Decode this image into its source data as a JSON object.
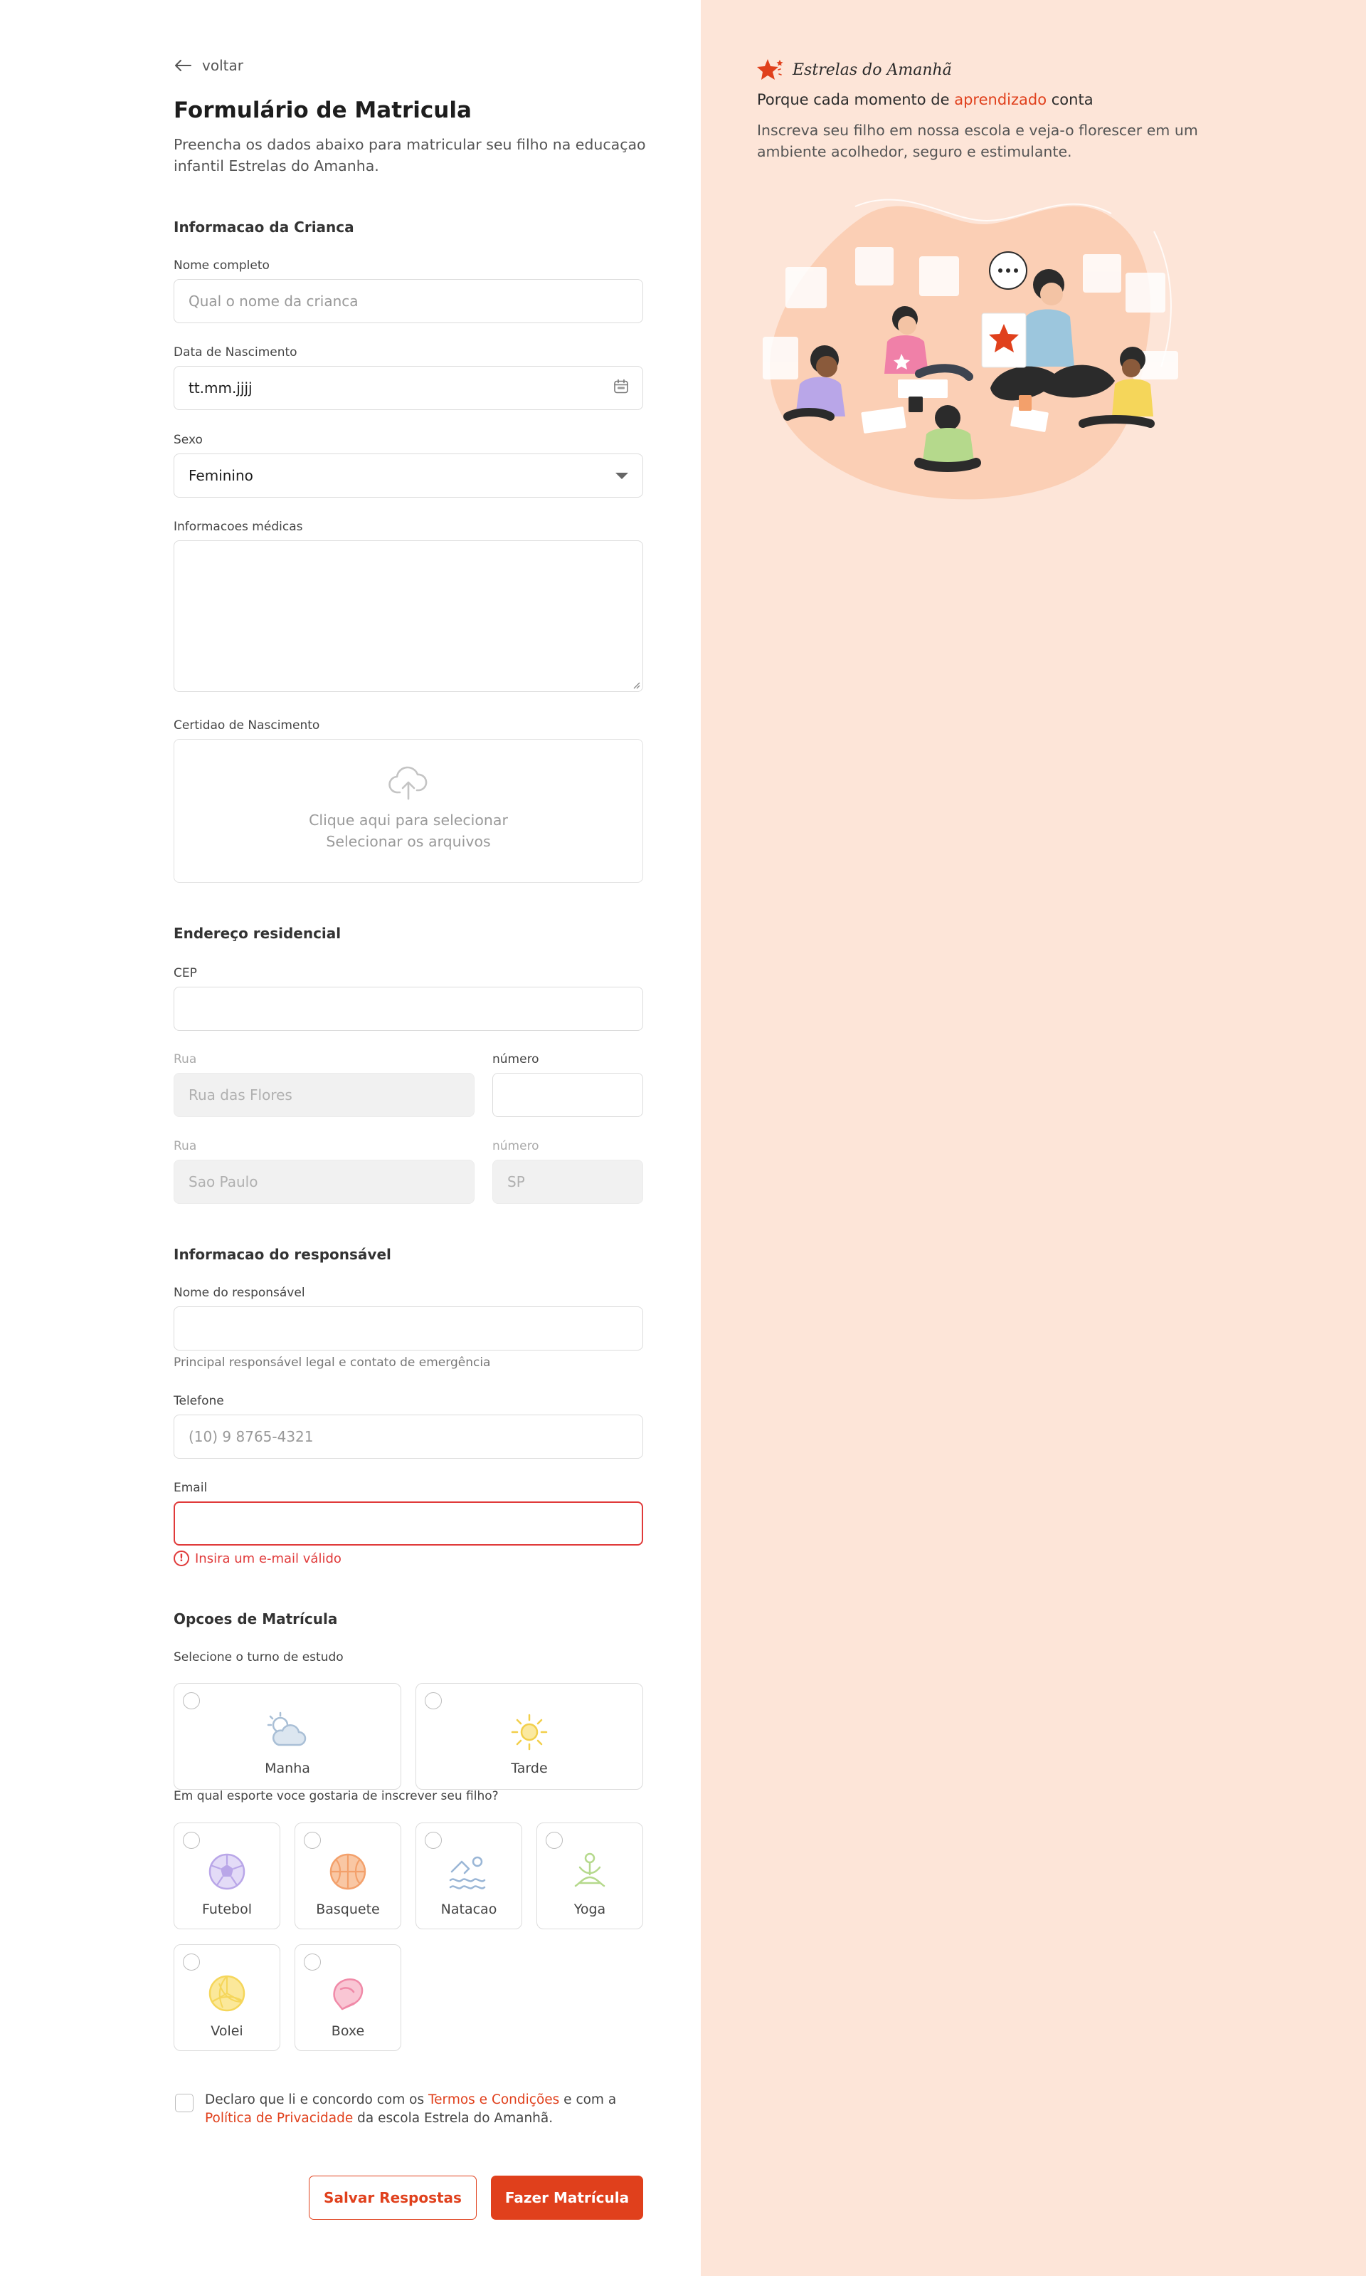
{
  "header": {
    "back_label": "voltar",
    "title": "Formulário de Matricula",
    "subtitle": "Preencha os dados abaixo para matricular seu filho na educaçao infantil Estrelas do Amanha."
  },
  "child": {
    "section_title": "Informacao da Crianca",
    "name_label": "Nome completo",
    "name_placeholder": "Qual o nome da crianca",
    "birth_label": "Data de Nascimento",
    "birth_value": "tt.mm.jjjj",
    "sex_label": "Sexo",
    "sex_value": "Feminino",
    "medical_label": "Informacoes médicas",
    "certificate_label": "Certidao de Nascimento",
    "upload_line1": "Clique aqui para selecionar",
    "upload_line2": "Selecionar os arquivos"
  },
  "address": {
    "section_title": "Endereço residencial",
    "cep_label": "CEP",
    "street_label": "Rua",
    "street_placeholder": "Rua das Flores",
    "number_label": "número",
    "city_label": "Rua",
    "city_placeholder": "Sao Paulo",
    "state_label": "número",
    "state_placeholder": "SP"
  },
  "guardian": {
    "section_title": "Informacao do responsável",
    "name_label": "Nome do responsável",
    "name_helper": "Principal responsável legal e contato de emergência",
    "phone_label": "Telefone",
    "phone_placeholder": "(10) 9 8765-4321",
    "email_label": "Email",
    "email_error": "Insira um e-mail válido"
  },
  "enrollment": {
    "section_title": "Opcoes de Matrícula",
    "shift_label": "Selecione o turno de estudo",
    "shifts": [
      {
        "label": "Manha",
        "icon": "cloud-sun-icon"
      },
      {
        "label": "Tarde",
        "icon": "sun-icon"
      }
    ],
    "sports_label": "Em qual esporte voce gostaria de inscrever seu filho?",
    "sports": [
      {
        "label": "Futebol",
        "icon": "soccer-ball-icon",
        "color": "#b9a6e8"
      },
      {
        "label": "Basquete",
        "icon": "basketball-icon",
        "color": "#f3a06b"
      },
      {
        "label": "Natacao",
        "icon": "swimmer-icon",
        "color": "#9ab6d6"
      },
      {
        "label": "Yoga",
        "icon": "yoga-icon",
        "color": "#b5d98c"
      },
      {
        "label": "Volei",
        "icon": "volleyball-icon",
        "color": "#f5d65a"
      },
      {
        "label": "Boxe",
        "icon": "boxing-glove-icon",
        "color": "#f08aa8"
      }
    ]
  },
  "consent": {
    "text_1": "Declaro que li e concordo com os ",
    "terms_link": "Termos e Condições",
    "text_2": " e com a ",
    "privacy_link": "Política de Privacidade",
    "text_3": " da escola Estrela do Amanhã."
  },
  "actions": {
    "save_label": "Salvar Respostas",
    "submit_label": "Fazer Matrícula"
  },
  "side": {
    "brand_name": "Estrelas do Amanhã",
    "tagline_pre": "Porque cada momento de ",
    "tagline_highlight": "aprendizado",
    "tagline_post": " conta",
    "description": "Inscreva seu filho em nossa escola e veja-o florescer em um ambiente acolhedor, seguro e estimulante."
  },
  "colors": {
    "accent": "#e0401c",
    "side_background": "#fde5d8",
    "error": "#e03a3a"
  }
}
